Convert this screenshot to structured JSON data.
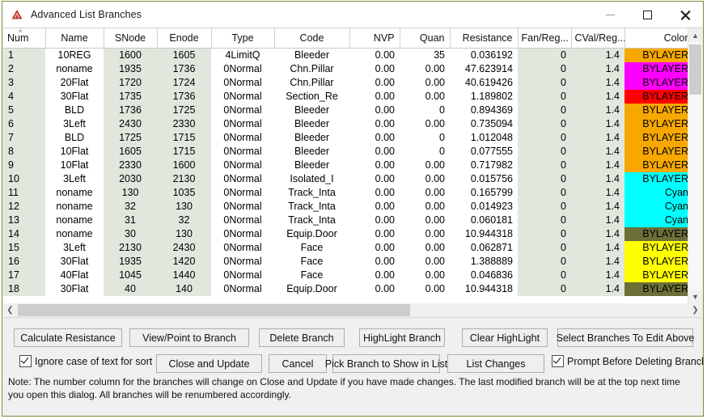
{
  "window": {
    "title": "Advanced List Branches",
    "icon": "autocad-triangle-icon",
    "border_color": "#7a8c3a",
    "buttons": {
      "minimize": "minimize-icon",
      "maximize": "maximize-icon",
      "close": "close-icon"
    }
  },
  "grid": {
    "sort_column": "Num",
    "sort_direction": "ascending",
    "columns": [
      {
        "key": "num",
        "label": "Num",
        "align": "left"
      },
      {
        "key": "name",
        "label": "Name",
        "align": "center"
      },
      {
        "key": "snode",
        "label": "SNode",
        "align": "center"
      },
      {
        "key": "enode",
        "label": "Enode",
        "align": "center"
      },
      {
        "key": "type",
        "label": "Type",
        "align": "center"
      },
      {
        "key": "code",
        "label": "Code",
        "align": "center"
      },
      {
        "key": "nvp",
        "label": "NVP",
        "align": "right"
      },
      {
        "key": "quan",
        "label": "Quan",
        "align": "right"
      },
      {
        "key": "res",
        "label": "Resistance",
        "align": "right"
      },
      {
        "key": "fan",
        "label": "Fan/Reg...",
        "align": "right"
      },
      {
        "key": "cval",
        "label": "CVal/Reg...",
        "align": "right"
      },
      {
        "key": "color",
        "label": "Color",
        "align": "right"
      }
    ],
    "row_shading": {
      "tinted": "#e1e7dd",
      "plain": "#ffffff"
    },
    "rows": [
      {
        "num": "1",
        "name": "10REG",
        "snode": "1600",
        "enode": "1605",
        "type": "4LimitQ",
        "code": "Bleeder",
        "nvp": "0.00",
        "quan": "35",
        "res": "0.036192",
        "fan": "0",
        "cval": "1.4",
        "color": "BYLAYER",
        "swatch": "#f6a800"
      },
      {
        "num": "2",
        "name": "noname",
        "snode": "1935",
        "enode": "1736",
        "type": "0Normal",
        "code": "Chn.Pillar",
        "nvp": "0.00",
        "quan": "0.00",
        "res": "47.623914",
        "fan": "0",
        "cval": "1.4",
        "color": "BYLAYER",
        "swatch": "#ff00ff"
      },
      {
        "num": "3",
        "name": "20Flat",
        "snode": "1720",
        "enode": "1724",
        "type": "0Normal",
        "code": "Chn.Pillar",
        "nvp": "0.00",
        "quan": "0.00",
        "res": "40.619426",
        "fan": "0",
        "cval": "1.4",
        "color": "BYLAYER",
        "swatch": "#ff00ff"
      },
      {
        "num": "4",
        "name": "30Flat",
        "snode": "1735",
        "enode": "1736",
        "type": "0Normal",
        "code": "Section_Re",
        "nvp": "0.00",
        "quan": "0.00",
        "res": "1.189802",
        "fan": "0",
        "cval": "1.4",
        "color": "BYLAYER",
        "swatch": "#ff0000"
      },
      {
        "num": "5",
        "name": "BLD",
        "snode": "1736",
        "enode": "1725",
        "type": "0Normal",
        "code": "Bleeder",
        "nvp": "0.00",
        "quan": "0",
        "res": "0.894369",
        "fan": "0",
        "cval": "1.4",
        "color": "BYLAYER",
        "swatch": "#f6a800"
      },
      {
        "num": "6",
        "name": "3Left",
        "snode": "2430",
        "enode": "2330",
        "type": "0Normal",
        "code": "Bleeder",
        "nvp": "0.00",
        "quan": "0.00",
        "res": "0.735094",
        "fan": "0",
        "cval": "1.4",
        "color": "BYLAYER",
        "swatch": "#f6a800"
      },
      {
        "num": "7",
        "name": "BLD",
        "snode": "1725",
        "enode": "1715",
        "type": "0Normal",
        "code": "Bleeder",
        "nvp": "0.00",
        "quan": "0",
        "res": "1.012048",
        "fan": "0",
        "cval": "1.4",
        "color": "BYLAYER",
        "swatch": "#f6a800"
      },
      {
        "num": "8",
        "name": "10Flat",
        "snode": "1605",
        "enode": "1715",
        "type": "0Normal",
        "code": "Bleeder",
        "nvp": "0.00",
        "quan": "0",
        "res": "0.077555",
        "fan": "0",
        "cval": "1.4",
        "color": "BYLAYER",
        "swatch": "#f6a800"
      },
      {
        "num": "9",
        "name": "10Flat",
        "snode": "2330",
        "enode": "1600",
        "type": "0Normal",
        "code": "Bleeder",
        "nvp": "0.00",
        "quan": "0.00",
        "res": "0.717982",
        "fan": "0",
        "cval": "1.4",
        "color": "BYLAYER",
        "swatch": "#f6a800"
      },
      {
        "num": "10",
        "name": "3Left",
        "snode": "2030",
        "enode": "2130",
        "type": "0Normal",
        "code": "Isolated_I",
        "nvp": "0.00",
        "quan": "0.00",
        "res": "0.015756",
        "fan": "0",
        "cval": "1.4",
        "color": "BYLAYER",
        "swatch": "#00ffff"
      },
      {
        "num": "11",
        "name": "noname",
        "snode": "130",
        "enode": "1035",
        "type": "0Normal",
        "code": "Track_Inta",
        "nvp": "0.00",
        "quan": "0.00",
        "res": "0.165799",
        "fan": "0",
        "cval": "1.4",
        "color": "Cyan",
        "swatch": "#00ffff"
      },
      {
        "num": "12",
        "name": "noname",
        "snode": "32",
        "enode": "130",
        "type": "0Normal",
        "code": "Track_Inta",
        "nvp": "0.00",
        "quan": "0.00",
        "res": "0.014923",
        "fan": "0",
        "cval": "1.4",
        "color": "Cyan",
        "swatch": "#00ffff"
      },
      {
        "num": "13",
        "name": "noname",
        "snode": "31",
        "enode": "32",
        "type": "0Normal",
        "code": "Track_Inta",
        "nvp": "0.00",
        "quan": "0.00",
        "res": "0.060181",
        "fan": "0",
        "cval": "1.4",
        "color": "Cyan",
        "swatch": "#00ffff"
      },
      {
        "num": "14",
        "name": "noname",
        "snode": "30",
        "enode": "130",
        "type": "0Normal",
        "code": "Equip.Door",
        "nvp": "0.00",
        "quan": "0.00",
        "res": "10.944318",
        "fan": "0",
        "cval": "1.4",
        "color": "BYLAYER",
        "swatch": "#6b7039"
      },
      {
        "num": "15",
        "name": "3Left",
        "snode": "2130",
        "enode": "2430",
        "type": "0Normal",
        "code": "Face",
        "nvp": "0.00",
        "quan": "0.00",
        "res": "0.062871",
        "fan": "0",
        "cval": "1.4",
        "color": "BYLAYER",
        "swatch": "#ffff00"
      },
      {
        "num": "16",
        "name": "30Flat",
        "snode": "1935",
        "enode": "1420",
        "type": "0Normal",
        "code": "Face",
        "nvp": "0.00",
        "quan": "0.00",
        "res": "1.388889",
        "fan": "0",
        "cval": "1.4",
        "color": "BYLAYER",
        "swatch": "#ffff00"
      },
      {
        "num": "17",
        "name": "40Flat",
        "snode": "1045",
        "enode": "1440",
        "type": "0Normal",
        "code": "Face",
        "nvp": "0.00",
        "quan": "0.00",
        "res": "0.046836",
        "fan": "0",
        "cval": "1.4",
        "color": "BYLAYER",
        "swatch": "#ffff00"
      },
      {
        "num": "18",
        "name": "30Flat",
        "snode": "40",
        "enode": "140",
        "type": "0Normal",
        "code": "Equip.Door",
        "nvp": "0.00",
        "quan": "0.00",
        "res": "10.944318",
        "fan": "0",
        "cval": "1.4",
        "color": "BYLAYER",
        "swatch": "#6b7039"
      }
    ]
  },
  "scrollbars": {
    "vertical_up": "chevron-up-icon",
    "vertical_down": "chevron-down-icon",
    "horizontal_left": "chevron-left-icon",
    "horizontal_right": "chevron-right-icon"
  },
  "actions": {
    "calculate_resistance": "Calculate Resistance",
    "view_point_to_branch": "View/Point to Branch",
    "delete_branch": "Delete Branch",
    "highlight_branch": "HighLight Branch",
    "clear_highlight": "Clear HighLight",
    "select_branches_to_edit": "Select Branches To Edit Above",
    "close_and_update": "Close and Update",
    "cancel": "Cancel",
    "pick_branch_to_show": "Pick Branch to Show in List",
    "list_changes": "List Changes"
  },
  "options": {
    "ignore_case": "Ignore case of text for sort",
    "ignore_case_checked": true,
    "prompt_before_delete": "Prompt Before Deleting Branches",
    "prompt_before_delete_checked": true
  },
  "note": "Note: The number column for the branches will change on Close and Update if you have made changes. The last modified branch will be at the top next time you open this dialog. All branches will be renumbered accordingly."
}
